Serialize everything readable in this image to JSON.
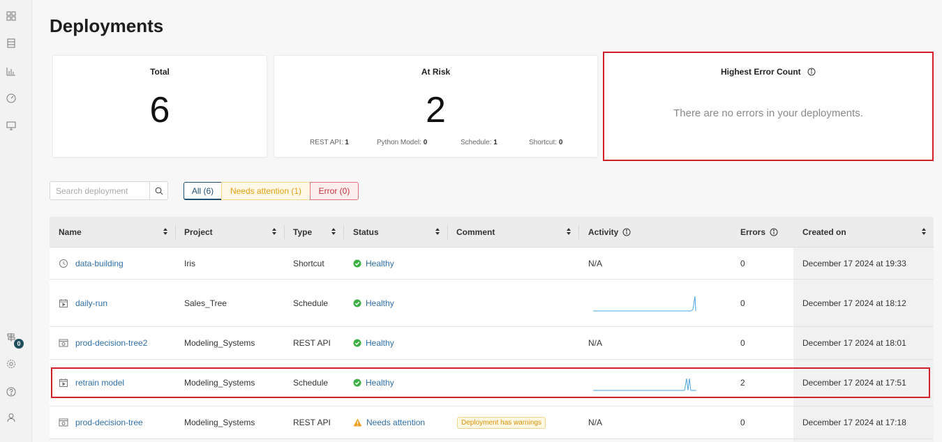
{
  "page_title": "Deployments",
  "cards": {
    "total": {
      "title": "Total",
      "value": "6"
    },
    "at_risk": {
      "title": "At Risk",
      "value": "2",
      "breakdown": [
        {
          "label": "REST API:",
          "value": "1"
        },
        {
          "label": "Python Model:",
          "value": "0"
        },
        {
          "label": "Schedule:",
          "value": "1"
        },
        {
          "label": "Shortcut:",
          "value": "0"
        }
      ]
    },
    "highest_error": {
      "title": "Highest Error Count",
      "message": "There are no errors in your deployments."
    }
  },
  "sidebar": {
    "notification_count": "0"
  },
  "search": {
    "placeholder": "Search deployment"
  },
  "filters": {
    "all": "All (6)",
    "needs_attention": "Needs attention (1)",
    "error": "Error (0)"
  },
  "table": {
    "headers": {
      "name": "Name",
      "project": "Project",
      "type": "Type",
      "status": "Status",
      "comment": "Comment",
      "activity": "Activity",
      "errors": "Errors",
      "created_on": "Created on"
    },
    "rows": [
      {
        "name": "data-building",
        "icon": "clock-icon",
        "project": "Iris",
        "type": "Shortcut",
        "status": "Healthy",
        "status_kind": "healthy",
        "comment": "",
        "activity": "N/A",
        "activity_spikes": [],
        "errors": "0",
        "created_on": "December 17 2024 at 19:33"
      },
      {
        "name": "daily-run",
        "icon": "calendar-icon",
        "project": "Sales_Tree",
        "type": "Schedule",
        "status": "Healthy",
        "status_kind": "healthy",
        "comment": "",
        "activity": "",
        "activity_spikes": [
          1
        ],
        "errors": "0",
        "created_on": "December 17 2024 at 18:12"
      },
      {
        "name": "prod-decision-tree2",
        "icon": "api-icon",
        "project": "Modeling_Systems",
        "type": "REST API",
        "status": "Healthy",
        "status_kind": "healthy",
        "comment": "",
        "activity": "N/A",
        "activity_spikes": [],
        "errors": "0",
        "created_on": "December 17 2024 at 18:01"
      },
      {
        "name": "retrain model",
        "icon": "calendar-icon",
        "project": "Modeling_Systems",
        "type": "Schedule",
        "status": "Healthy",
        "status_kind": "healthy",
        "comment": "",
        "activity": "",
        "activity_spikes": [
          2
        ],
        "errors": "2",
        "created_on": "December 17 2024 at 17:51"
      },
      {
        "name": "prod-decision-tree",
        "icon": "api-icon",
        "project": "Modeling_Systems",
        "type": "REST API",
        "status": "Needs attention",
        "status_kind": "warning",
        "comment": "Deployment has warnings",
        "activity": "N/A",
        "activity_spikes": [],
        "errors": "0",
        "created_on": "December 17 2024 at 17:18"
      }
    ]
  },
  "colors": {
    "link": "#2f6fa8",
    "healthy": "#3cb043",
    "warning": "#f0a020",
    "highlight": "#d21f2a",
    "spark": "#4aa3df"
  }
}
